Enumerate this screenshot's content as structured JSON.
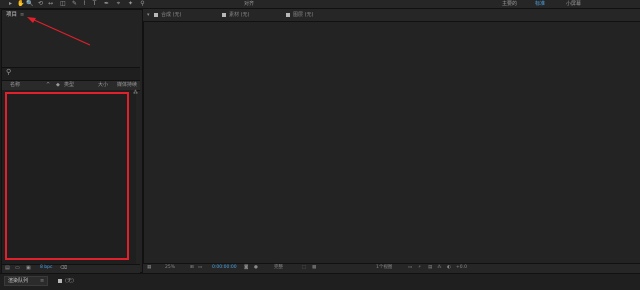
{
  "toolbar": {
    "tools": [
      "▸",
      "✋",
      "🔍",
      "⟲",
      "↔",
      "◫",
      "✎",
      "⌇",
      "T",
      "✒",
      "⌖",
      "✦",
      "⚲"
    ],
    "snap_label": "对齐",
    "workspaces": [
      "主要的",
      "标准",
      "小屏幕"
    ],
    "active_workspace": "标准"
  },
  "project_panel": {
    "tab_label": "项目",
    "close": "≡",
    "columns": {
      "name": "名称",
      "type": "类型",
      "size": "大小",
      "frame_rate": "媒体持续"
    },
    "footer_bpc": "8 bpc"
  },
  "viewer": {
    "tabs": [
      {
        "label": "合成 (无)",
        "active": true
      },
      {
        "label": "素材 (无)",
        "active": false
      },
      {
        "label": "图层 (无)",
        "active": false
      }
    ],
    "footer": {
      "zoom": "25%",
      "timecode": "0:00:00:00",
      "resolution": "完整",
      "views": "1个视图",
      "exposure": "+0.0"
    }
  },
  "timeline": {
    "tab_label": "渲染队列",
    "close": "≡",
    "comp_label": "(无)"
  },
  "annotation": {
    "color": "#e0202a"
  }
}
